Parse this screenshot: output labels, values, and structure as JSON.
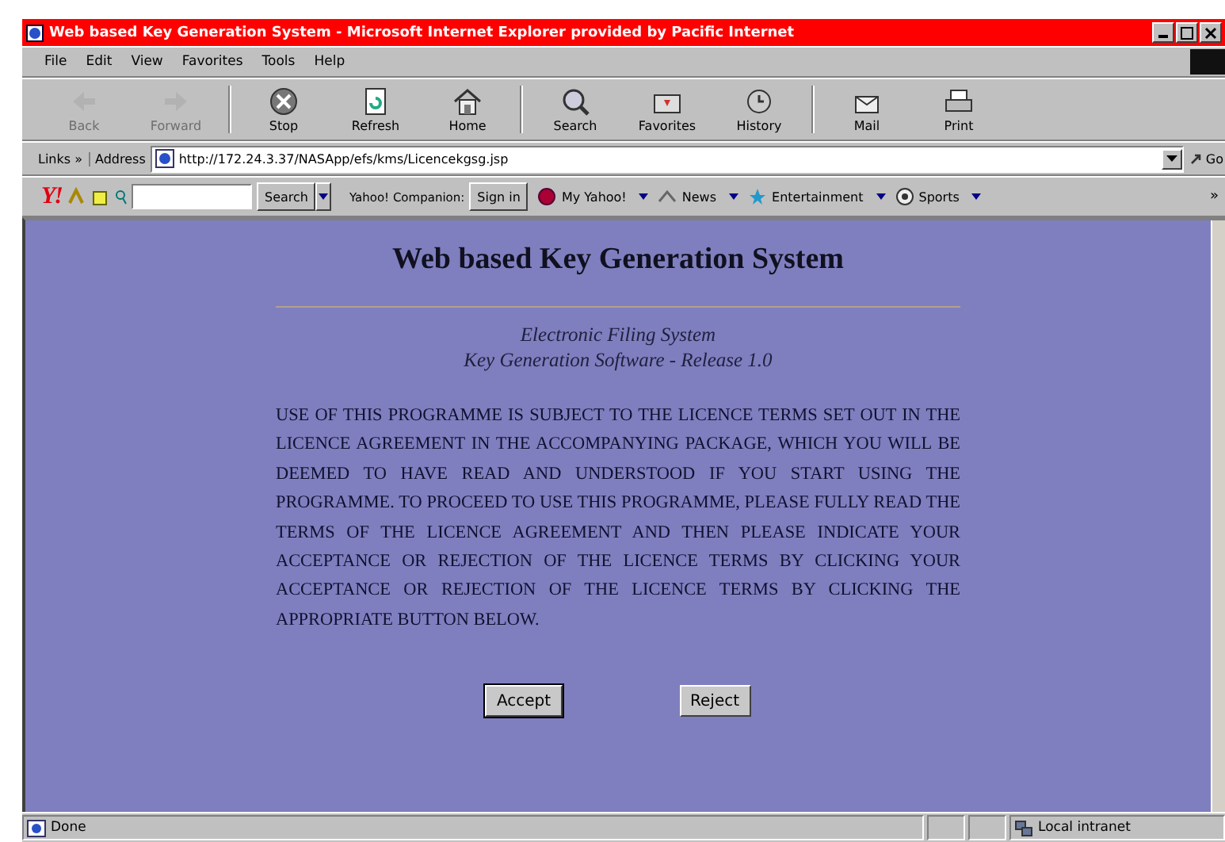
{
  "window": {
    "title": "Web based Key Generation System - Microsoft Internet Explorer provided by Pacific Internet"
  },
  "menu": [
    "File",
    "Edit",
    "View",
    "Favorites",
    "Tools",
    "Help"
  ],
  "toolbar": [
    {
      "kind": "back",
      "label": "Back",
      "disabled": true
    },
    {
      "kind": "forward",
      "label": "Forward",
      "disabled": true
    },
    {
      "kind": "stop",
      "label": "Stop",
      "disabled": false
    },
    {
      "kind": "refresh",
      "label": "Refresh",
      "disabled": false
    },
    {
      "kind": "home",
      "label": "Home",
      "disabled": false
    },
    {
      "kind": "search",
      "label": "Search",
      "disabled": false
    },
    {
      "kind": "favorites",
      "label": "Favorites",
      "disabled": false
    },
    {
      "kind": "history",
      "label": "History",
      "disabled": false
    },
    {
      "kind": "mail",
      "label": "Mail",
      "disabled": false
    },
    {
      "kind": "print",
      "label": "Print",
      "disabled": false
    }
  ],
  "address_bar": {
    "links_label": "Links",
    "links_more": "»",
    "label": "Address",
    "url": "http://172.24.3.37/NASApp/efs/kms/Licencekgsg.jsp",
    "go": "Go"
  },
  "yahoo_bar": {
    "logo": "Y!",
    "search_button": "Search",
    "companion_label": "Yahoo! Companion:",
    "sign_in": "Sign in",
    "links": [
      "My Yahoo!",
      "News",
      "Entertainment",
      "Sports"
    ],
    "more": "»"
  },
  "page": {
    "title": "Web based Key Generation System",
    "subtitle": [
      "Electronic Filing System",
      "Key Generation Software - Release 1.0"
    ],
    "notice": "USE OF THIS PROGRAMME IS SUBJECT TO THE LICENCE TERMS SET OUT IN THE LICENCE AGREEMENT IN THE ACCOMPANYING PACKAGE, WHICH YOU WILL BE DEEMED TO HAVE READ AND UNDERSTOOD IF YOU START USING THE PROGRAMME. TO PROCEED TO USE THIS PROGRAMME, PLEASE FULLY READ THE TERMS OF THE LICENCE AGREEMENT AND THEN PLEASE INDICATE YOUR ACCEPTANCE OR REJECTION OF THE LICENCE TERMS BY CLICKING YOUR ACCEPTANCE OR REJECTION OF THE LICENCE TERMS BY CLICKING THE APPROPRIATE BUTTON BELOW.",
    "buttons": [
      "Accept",
      "Reject"
    ]
  },
  "status_bar": {
    "text": "Done",
    "zone": "Local intranet"
  }
}
